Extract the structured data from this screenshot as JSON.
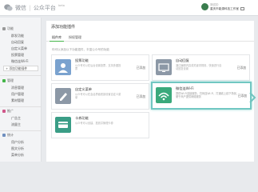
{
  "header": {
    "brand": "微信",
    "platform": "公众平台",
    "beta": "beta",
    "account_line1": "测试中",
    "account_line2": "重庆市能源科技工作室"
  },
  "sidebar": {
    "sections": [
      {
        "title": "功能",
        "items": [
          "群发功能",
          "自动回复",
          "自定义菜单",
          "投票管理",
          "微信连Wi-Fi"
        ]
      },
      {
        "add_plugin": "+ 添加功能插件"
      },
      {
        "title": "管理",
        "items": [
          "消息管理",
          "用户管理",
          "素材管理"
        ]
      },
      {
        "title": "推广",
        "items": [
          "广告主",
          "流量主"
        ]
      },
      {
        "title": "统计",
        "items": [
          "用户分析",
          "图文分析",
          "菜单分析"
        ]
      }
    ]
  },
  "main": {
    "title": "添加功能插件",
    "tabs": [
      "插件库",
      "授权管理"
    ],
    "hint": "你可以添加以下功能插件，丰富公众号的功能",
    "cards": [
      {
        "name": "投票功能",
        "desc": "公众号可以在后台设置投票，支持多图投票",
        "status": "已添加"
      },
      {
        "name": "自动回复",
        "desc": "通过编辑内容或关键词规则，快速进行自动回复设置",
        "status": "已添加"
      },
      {
        "name": "自定义菜单",
        "desc": "公众号可以在会话界面底部设置自定义菜单",
        "status": "已添加"
      },
      {
        "name": "微信连Wi-Fi",
        "desc": "提供Wi-Fi连接服务，扫码连Wi-Fi，打通线上线下场景，便于商户提供网络服务",
        "status": "已添加"
      },
      {
        "name": "卡券功能",
        "desc": "公众号可以创建、投放并管理卡券",
        "status": ""
      }
    ]
  }
}
